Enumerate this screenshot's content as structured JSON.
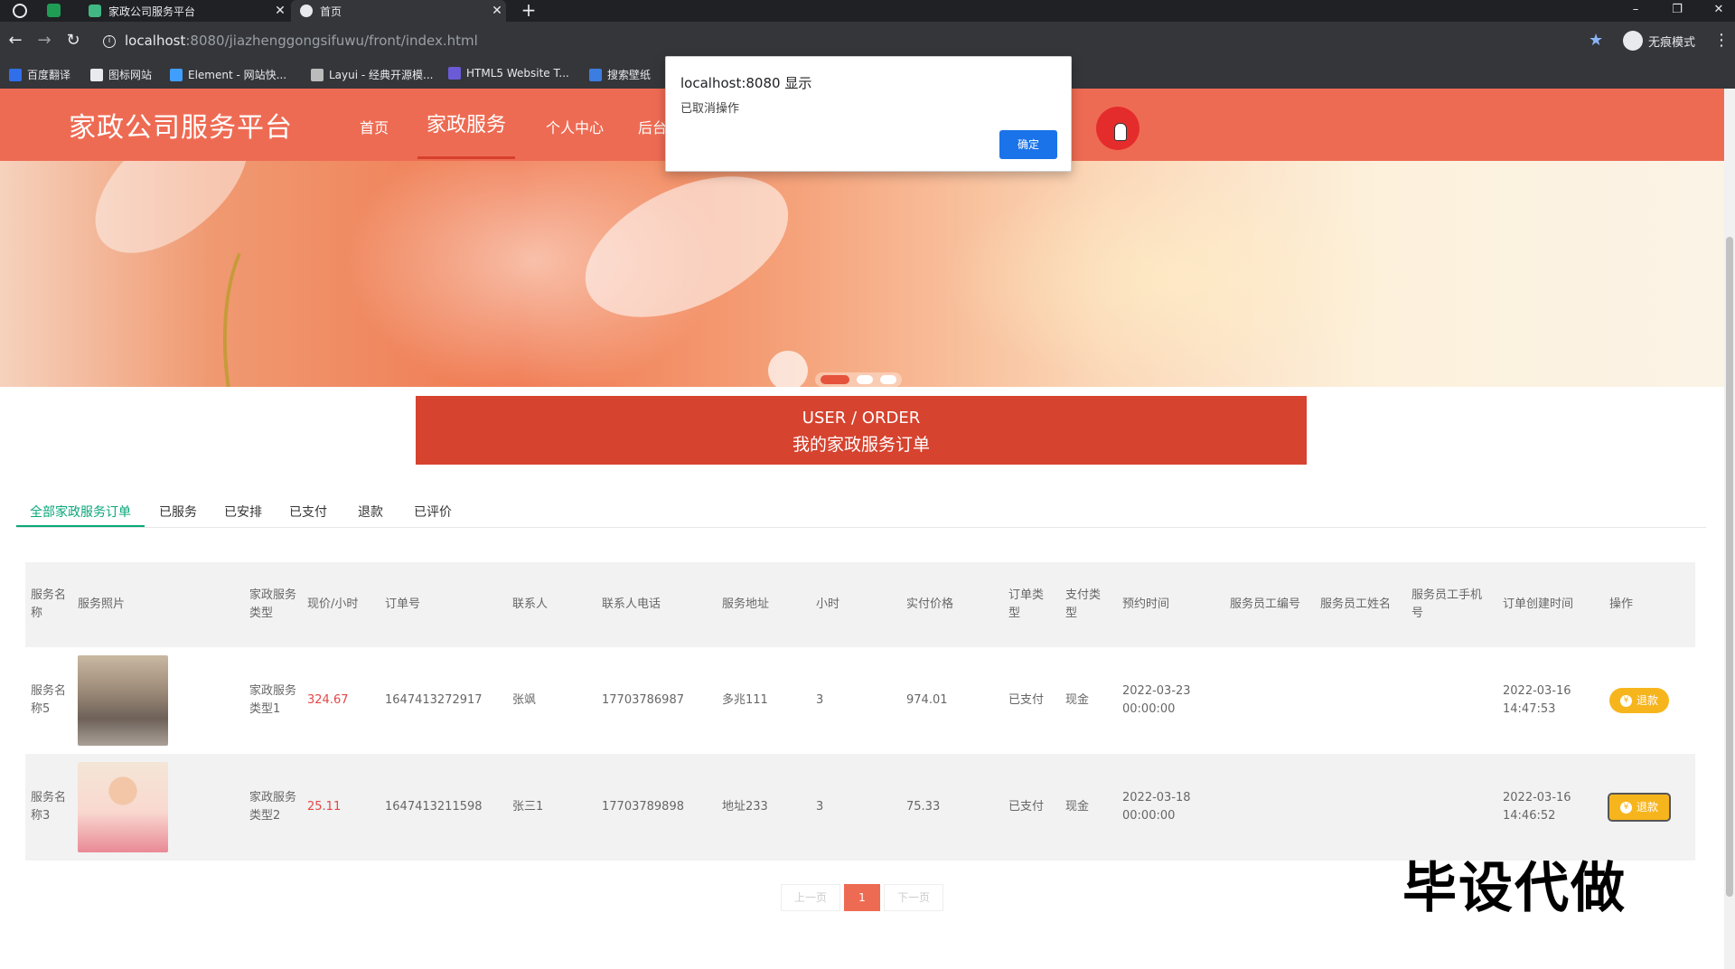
{
  "browser": {
    "tabs": [
      {
        "title": "家政公司服务平台",
        "active": false
      },
      {
        "title": "首页",
        "active": true
      }
    ],
    "url_host": "localhost",
    "url_rest": ":8080/jiazhenggongsifuwu/front/index.html",
    "incognito_label": "无痕模式",
    "bookmarks": [
      "百度翻译",
      "图标网站",
      "Element - 网站快...",
      "Layui - 经典开源模...",
      "HTML5 Website T...",
      "搜索壁纸"
    ]
  },
  "site": {
    "logo": "家政公司服务平台",
    "nav": [
      {
        "label": "首页",
        "active": false
      },
      {
        "label": "家政服务",
        "active": true
      },
      {
        "label": "个人中心",
        "active": false
      },
      {
        "label": "后台",
        "active": false
      }
    ]
  },
  "order_box": {
    "en": "USER / ORDER",
    "cn": "我的家政服务订单"
  },
  "order_tabs": [
    {
      "label": "全部家政服务订单",
      "active": true
    },
    {
      "label": "已服务",
      "active": false
    },
    {
      "label": "已安排",
      "active": false
    },
    {
      "label": "已支付",
      "active": false
    },
    {
      "label": "退款",
      "active": false
    },
    {
      "label": "已评价",
      "active": false
    }
  ],
  "table": {
    "headers": [
      "服务名称",
      "服务照片",
      "家政服务类型",
      "现价/小时",
      "订单号",
      "联系人",
      "联系人电话",
      "服务地址",
      "小时",
      "实付价格",
      "订单类型",
      "支付类型",
      "预约时间",
      "服务员工编号",
      "服务员工姓名",
      "服务员工手机号",
      "订单创建时间",
      "操作"
    ],
    "rows": [
      {
        "name": "服务名称5",
        "photo": "photo-cleaning",
        "type": "家政服务类型1",
        "price": "324.67",
        "order_no": "1647413272917",
        "contact": "张飒",
        "phone": "17703786987",
        "address": "多兆111",
        "hours": "3",
        "paid": "974.01",
        "order_type": "已支付",
        "pay_type": "现金",
        "appointment": "2022-03-23 00:00:00",
        "staff_no": "",
        "staff_name": "",
        "staff_phone": "",
        "created": "2022-03-16 14:47:53",
        "action": "退款"
      },
      {
        "name": "服务名称3",
        "photo": "photo-cartoon-maid",
        "type": "家政服务类型2",
        "price": "25.11",
        "order_no": "1647413211598",
        "contact": "张三1",
        "phone": "17703789898",
        "address": "地址233",
        "hours": "3",
        "paid": "75.33",
        "order_type": "已支付",
        "pay_type": "现金",
        "appointment": "2022-03-18 00:00:00",
        "staff_no": "",
        "staff_name": "",
        "staff_phone": "",
        "created": "2022-03-16 14:46:52",
        "action": "退款"
      }
    ]
  },
  "pager": {
    "prev": "上一页",
    "page": "1",
    "next": "下一页"
  },
  "dialog": {
    "title": "localhost:8080 显示",
    "message": "已取消操作",
    "ok": "确定"
  },
  "watermark": "毕设代做",
  "colors": {
    "header": "#ee6b53",
    "order_box": "#d6432f",
    "active_tab": "#0aa77a",
    "price": "#e54646",
    "refund": "#f7b51d",
    "dialog_ok": "#1a73e8"
  }
}
